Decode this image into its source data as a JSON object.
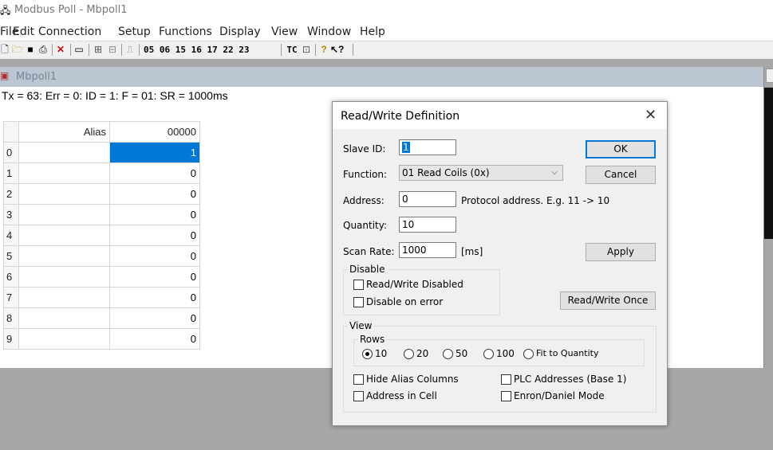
{
  "app": {
    "title": "Modbus Poll - Mbpoll1",
    "icon": "app-icon"
  },
  "menu": [
    "File",
    "Edit",
    "Connection",
    "Setup",
    "Functions",
    "Display",
    "View",
    "Window",
    "Help"
  ],
  "toolbar": {
    "codes": "05 06 15 16 17 22 23",
    "tc": "TC",
    "icons": [
      "new-icon",
      "open-icon",
      "save-icon",
      "print-icon",
      "delete-icon",
      "window-icon",
      "connect-icon",
      "disconnect-icon",
      "pulse-icon",
      "monitor-icon",
      "help-icon",
      "whats-this-icon"
    ]
  },
  "child": {
    "title": "Mbpoll1",
    "status": "Tx = 63: Err = 0: ID = 1: F = 01: SR = 1000ms",
    "columns": {
      "alias": "Alias",
      "address": "00000"
    },
    "rows": [
      {
        "index": "0",
        "alias": "",
        "value": "1"
      },
      {
        "index": "1",
        "alias": "",
        "value": "0"
      },
      {
        "index": "2",
        "alias": "",
        "value": "0"
      },
      {
        "index": "3",
        "alias": "",
        "value": "0"
      },
      {
        "index": "4",
        "alias": "",
        "value": "0"
      },
      {
        "index": "5",
        "alias": "",
        "value": "0"
      },
      {
        "index": "6",
        "alias": "",
        "value": "0"
      },
      {
        "index": "7",
        "alias": "",
        "value": "0"
      },
      {
        "index": "8",
        "alias": "",
        "value": "0"
      },
      {
        "index": "9",
        "alias": "",
        "value": "0"
      }
    ]
  },
  "dialog": {
    "title": "Read/Write Definition",
    "close": "✕",
    "slave_id_label": "Slave ID:",
    "slave_id": "1",
    "function_label": "Function:",
    "function": "01 Read Coils (0x)",
    "address_label": "Address:",
    "address": "0",
    "address_hint": "Protocol address. E.g. 11 -> 10",
    "quantity_label": "Quantity:",
    "quantity": "10",
    "scan_rate_label": "Scan Rate:",
    "scan_rate": "1000",
    "scan_rate_unit": "[ms]",
    "ok": "OK",
    "cancel": "Cancel",
    "apply": "Apply",
    "read_write_once": "Read/Write Once",
    "disable_group": "Disable",
    "rw_disabled": "Read/Write Disabled",
    "disable_on_error": "Disable on error",
    "view_group": "View",
    "rows_group": "Rows",
    "rows_options": [
      "10",
      "20",
      "50",
      "100",
      "Fit to Quantity"
    ],
    "rows_selected": "10",
    "hide_alias": "Hide Alias Columns",
    "address_in_cell": "Address in Cell",
    "plc_addresses": "PLC Addresses (Base 1)",
    "enron_mode": "Enron/Daniel Mode"
  },
  "colors": {
    "selection": "#0078d7",
    "child_title_bg": "#bcc6d3",
    "workspace": "#a7a7a7"
  }
}
